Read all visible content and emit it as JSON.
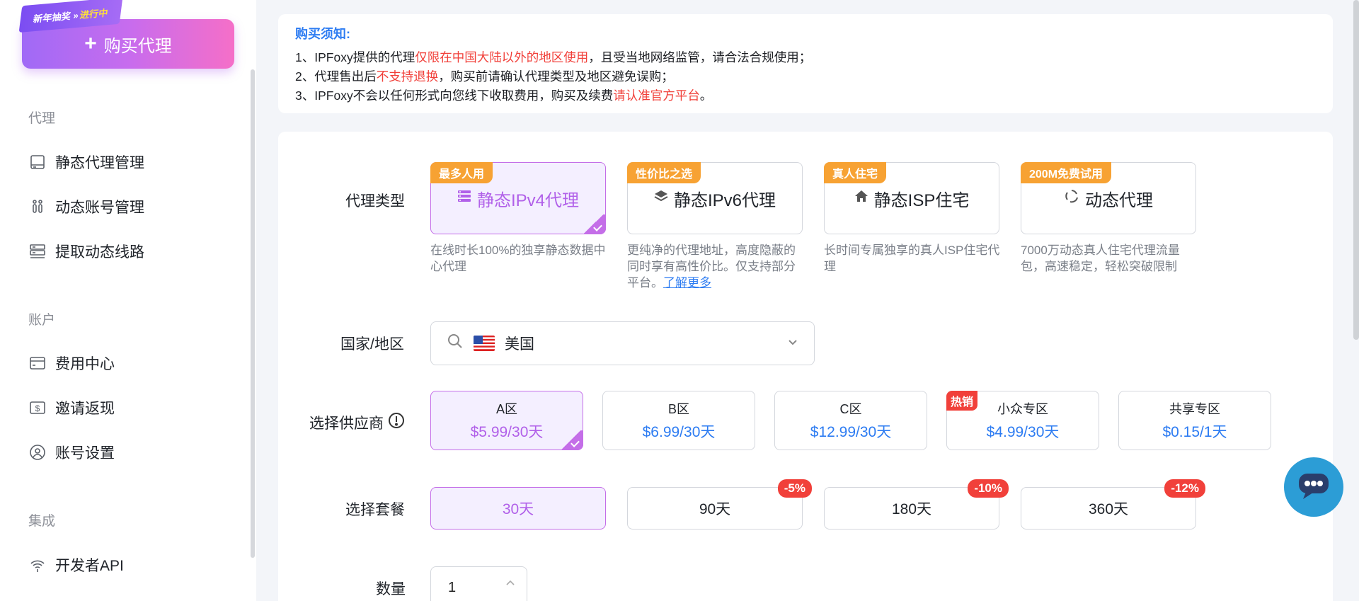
{
  "sidebar": {
    "promo": {
      "text": "新年抽奖 »",
      "hot": "进行中"
    },
    "buy_label": "购买代理",
    "sections": [
      {
        "title": "代理",
        "items": [
          {
            "label": "静态代理管理",
            "icon": "monitor-icon"
          },
          {
            "label": "动态账号管理",
            "icon": "users-icon"
          },
          {
            "label": "提取动态线路",
            "icon": "server-icon"
          }
        ]
      },
      {
        "title": "账户",
        "items": [
          {
            "label": "费用中心",
            "icon": "card-icon"
          },
          {
            "label": "邀请返现",
            "icon": "dollar-icon"
          },
          {
            "label": "账号设置",
            "icon": "user-icon"
          }
        ]
      },
      {
        "title": "集成",
        "items": [
          {
            "label": "开发者API",
            "icon": "signal-icon"
          }
        ]
      }
    ]
  },
  "notice": {
    "title": "购买须知:",
    "line1": {
      "a": "1、IPFoxy提供的代理",
      "red": "仅限在中国大陆以外的地区使用",
      "b": "，且受当地网络监管，请合法合规使用；"
    },
    "line2": {
      "a": "2、代理售出后",
      "red": "不支持退换",
      "b": "，购买前请确认代理类型及地区避免误购；"
    },
    "line3": {
      "a": "3、IPFoxy不会以任何形式向您线下收取费用，购买及续费",
      "red": "请认准官方平台",
      "b": "。"
    }
  },
  "form": {
    "type_label": "代理类型",
    "types": [
      {
        "badge": "最多人用",
        "label": "静态IPv4代理",
        "desc": "在线时长100%的独享静态数据中心代理",
        "active": true
      },
      {
        "badge": "性价比之选",
        "label": "静态IPv6代理",
        "desc": "更纯净的代理地址，高度隐蔽的同时享有高性价比。仅支持部分平台。",
        "link": "了解更多"
      },
      {
        "badge": "真人住宅",
        "label": "静态ISP住宅",
        "desc": "长时间专属独享的真人ISP住宅代理"
      },
      {
        "badge": "200M免费试用",
        "label": "动态代理",
        "desc": "7000万动态真人住宅代理流量包，高速稳定，轻松突破限制"
      }
    ],
    "country_label": "国家/地区",
    "country_value": "美国",
    "provider_label": "选择供应商",
    "providers": [
      {
        "name": "A区",
        "price": "$5.99/30天",
        "active": true
      },
      {
        "name": "B区",
        "price": "$6.99/30天"
      },
      {
        "name": "C区",
        "price": "$12.99/30天"
      },
      {
        "name": "小众专区",
        "price": "$4.99/30天",
        "badge": "热销"
      },
      {
        "name": "共享专区",
        "price": "$0.15/1天"
      }
    ],
    "plan_label": "选择套餐",
    "plans": [
      {
        "label": "30天",
        "active": true
      },
      {
        "label": "90天",
        "discount": "-5%"
      },
      {
        "label": "180天",
        "discount": "-10%"
      },
      {
        "label": "360天",
        "discount": "-12%"
      }
    ],
    "qty_label": "数量",
    "qty_value": "1"
  },
  "colors": {
    "accent": "#b160e9",
    "blue": "#2d7cf2",
    "red": "#f1403a",
    "orange": "#f7a233"
  }
}
